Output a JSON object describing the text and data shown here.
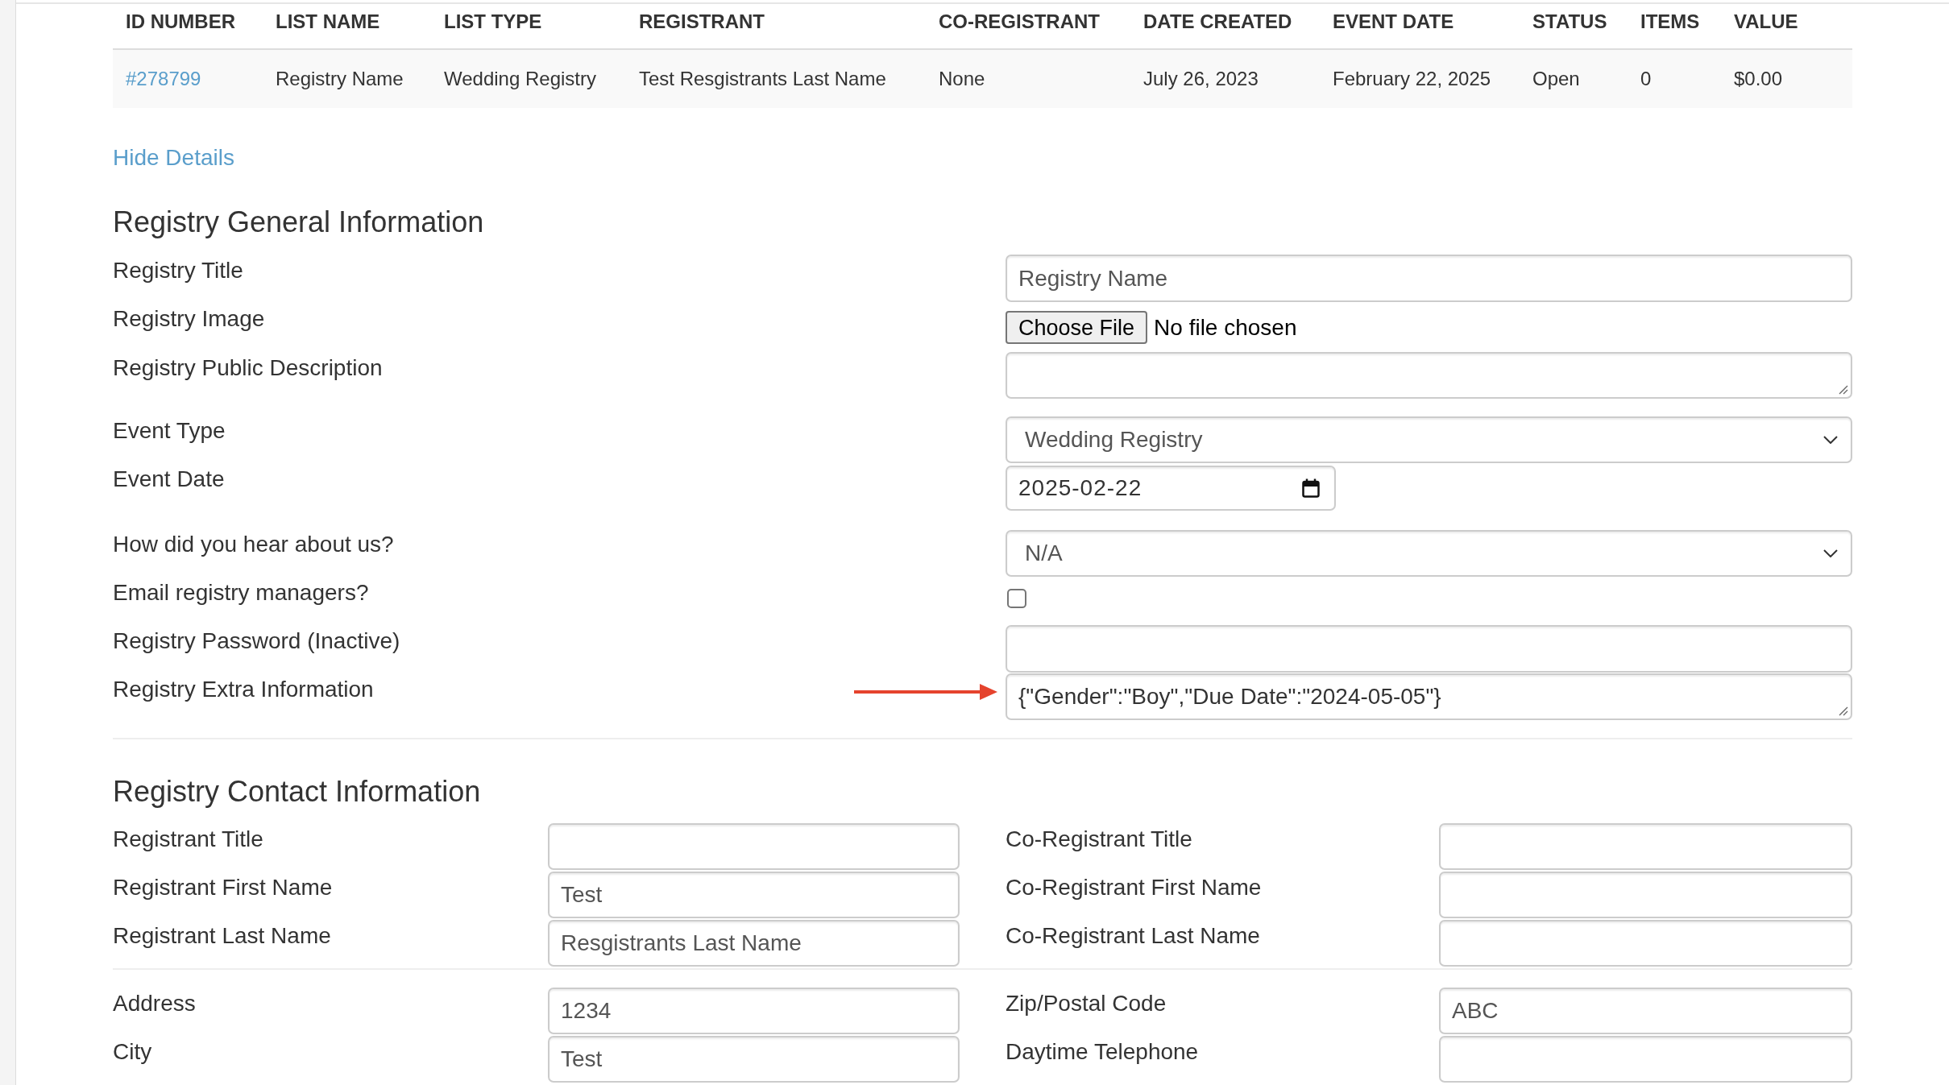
{
  "table": {
    "columns": [
      "ID NUMBER",
      "LIST NAME",
      "LIST TYPE",
      "REGISTRANT",
      "CO-REGISTRANT",
      "DATE CREATED",
      "EVENT DATE",
      "STATUS",
      "ITEMS",
      "VALUE"
    ],
    "rows": [
      {
        "cells": [
          {
            "kind": "link",
            "text": "#278799"
          },
          {
            "kind": "text",
            "text": "Registry Name"
          },
          {
            "kind": "text",
            "text": "Wedding Registry"
          },
          {
            "kind": "text",
            "text": "Test Resgistrants Last Name"
          },
          {
            "kind": "text",
            "text": "None"
          },
          {
            "kind": "text",
            "text": "July 26, 2023"
          },
          {
            "kind": "text",
            "text": "February 22, 2025"
          },
          {
            "kind": "text",
            "text": "Open"
          },
          {
            "kind": "text",
            "text": "0"
          },
          {
            "kind": "text",
            "text": "$0.00"
          }
        ]
      }
    ]
  },
  "hide_details_link": "Hide Details",
  "general_section": {
    "title": "Registry General Information",
    "fields": [
      {
        "label": "Registry Title",
        "kind": "text",
        "value": "Registry Name"
      },
      {
        "label": "Registry Image",
        "kind": "file",
        "button": "Choose File",
        "status": "No file chosen"
      },
      {
        "label": "Registry Public Description",
        "kind": "textarea"
      },
      {
        "label": "Event Type",
        "kind": "select",
        "value": "Wedding Registry"
      },
      {
        "label": "Event Date",
        "kind": "date",
        "value": "2025-02-22"
      },
      {
        "label": "How did you hear about us?",
        "kind": "select",
        "value": "N/A"
      },
      {
        "label": "Email registry managers?",
        "kind": "checkbox",
        "checked": false
      },
      {
        "label": "Registry Password (Inactive)",
        "kind": "text"
      },
      {
        "label": "Registry Extra Information",
        "kind": "textarea",
        "value": "{\"Gender\":\"Boy\",\"Due Date\":\"2024-05-05\"}",
        "arrow": true
      }
    ]
  },
  "contact_section": {
    "title": "Registry Contact Information",
    "groups": [
      {
        "rows": [
          {
            "left": {
              "label": "Registrant Title"
            },
            "right": {
              "label": "Co-Registrant Title"
            }
          },
          {
            "left": {
              "label": "Registrant First Name",
              "value": "Test"
            },
            "right": {
              "label": "Co-Registrant First Name"
            }
          },
          {
            "left": {
              "label": "Registrant Last Name",
              "value": "Resgistrants Last Name"
            },
            "right": {
              "label": "Co-Registrant Last Name"
            }
          }
        ]
      },
      {
        "rows": [
          {
            "left": {
              "label": "Address",
              "value": "1234"
            },
            "right": {
              "label": "Zip/Postal Code",
              "value": "ABC"
            }
          },
          {
            "left": {
              "label": "City",
              "value": "Test"
            },
            "right": {
              "label": "Daytime Telephone"
            }
          }
        ]
      }
    ]
  }
}
